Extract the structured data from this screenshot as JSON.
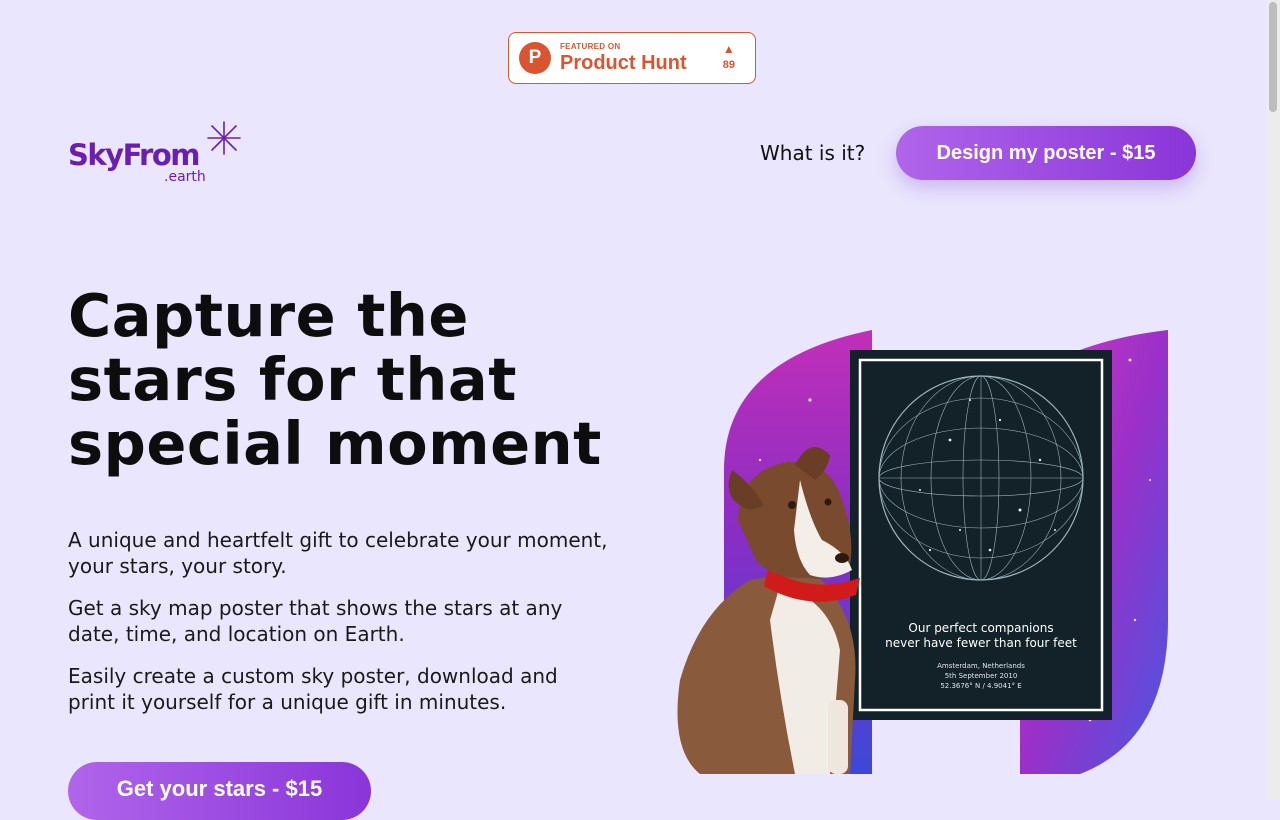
{
  "product_hunt": {
    "featured": "FEATURED ON",
    "name": "Product Hunt",
    "logo_letter": "P",
    "votes": "89",
    "color": "#da552f"
  },
  "brand": {
    "name": "SkyFrom",
    "tld": ".earth",
    "color": "#6a1fb0"
  },
  "nav": {
    "what_is_it": "What is it?",
    "cta": "Design my poster - $15"
  },
  "hero": {
    "title": "Capture the stars for that special moment",
    "paragraphs": [
      "A unique and heartfelt gift to celebrate your moment, your stars, your story.",
      "Get a sky map poster that shows the stars at any date, time, and location on Earth.",
      "Easily create a custom sky poster, download and print it yourself for a unique gift in minutes."
    ],
    "cta": "Get your stars - $15"
  },
  "poster": {
    "quote_line1": "Our perfect companions",
    "quote_line2": "never have fewer than four feet",
    "location": "Amsterdam, Netherlands",
    "date": "5th September 2010",
    "coords": "52.3676° N / 4.9041° E"
  },
  "colors": {
    "background": "#e9e6fd",
    "accent": "#9b4ce3",
    "poster_bg": "#132228"
  }
}
